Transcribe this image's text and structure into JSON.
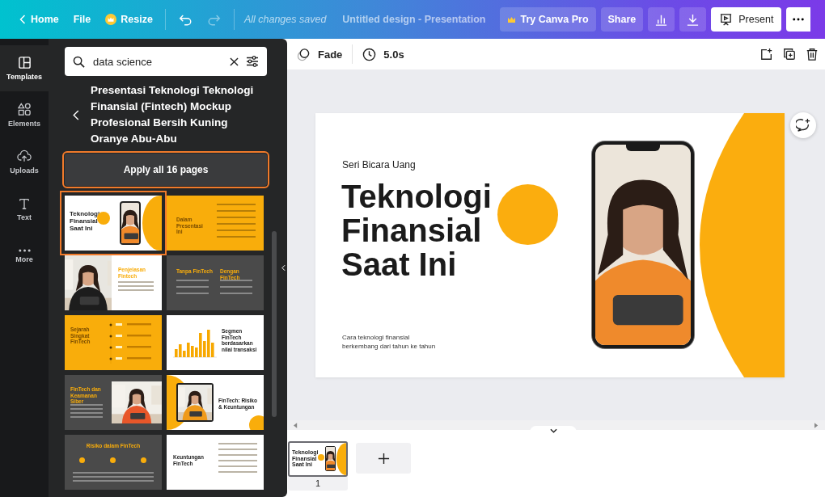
{
  "topbar": {
    "home": "Home",
    "file": "File",
    "resize": "Resize",
    "save_status": "All changes saved",
    "title": "Untitled design - Presentation",
    "pro_button": "Try Canva Pro",
    "share_button": "Share",
    "present_button": "Present"
  },
  "rail": [
    {
      "kind": "templates",
      "label": "Templates",
      "selected": true
    },
    {
      "kind": "elements",
      "label": "Elements",
      "selected": false
    },
    {
      "kind": "uploads",
      "label": "Uploads",
      "selected": false
    },
    {
      "kind": "text",
      "label": "Text",
      "selected": false
    },
    {
      "kind": "more",
      "label": "More",
      "selected": false
    }
  ],
  "panel": {
    "search": {
      "value": "data science"
    },
    "template_name": "Presentasi Teknologi Teknologi Finansial (Fintech) Mockup Profesional Bersih Kuning Oranye Abu-Abu",
    "apply_button": {
      "label": "Apply all 16 pages",
      "highlighted": true
    },
    "thumbnails": [
      {
        "kind": "cover",
        "titles": [
          "Teknologi Finansial Saat Ini"
        ],
        "selected": true
      },
      {
        "kind": "agenda",
        "titles": [
          "Dalam Presentasi Ini"
        ],
        "selected": false
      },
      {
        "kind": "photo-text",
        "titles": [
          "Penjelasan Fintech"
        ],
        "selected": false
      },
      {
        "kind": "two-column",
        "titles": [
          "Tanpa FinTech",
          "Dengan FinTech"
        ],
        "selected": false
      },
      {
        "kind": "timeline",
        "titles": [
          "Sejarah Singkat FinTech"
        ],
        "selected": false
      },
      {
        "kind": "chart",
        "titles": [
          "Segmen FinTech berdasarkan nilai transaksi"
        ],
        "selected": false
      },
      {
        "kind": "text-photo",
        "titles": [
          "FinTech dan Keamanan Siber"
        ],
        "selected": false
      },
      {
        "kind": "device",
        "titles": [
          "FinTech: Risiko & Keuntungan"
        ],
        "selected": false
      },
      {
        "kind": "three-column",
        "titles": [
          "Risiko dalam FinTech"
        ],
        "selected": false
      },
      {
        "kind": "text-list",
        "titles": [
          "Keuntungan FinTech"
        ],
        "selected": false
      }
    ]
  },
  "toolbar": {
    "transition": "Fade",
    "duration": "5.0s"
  },
  "slide": {
    "kicker": "Seri Bicara Uang",
    "title_lines": [
      "Teknologi",
      "Finansial",
      "Saat Ini"
    ],
    "caption_lines": [
      "Cara teknologi finansial",
      "berkembang dari tahun ke tahun"
    ]
  },
  "pages": [
    {
      "number": "1",
      "title": "Teknologi Finansial Saat Ini",
      "selected": true
    }
  ]
}
